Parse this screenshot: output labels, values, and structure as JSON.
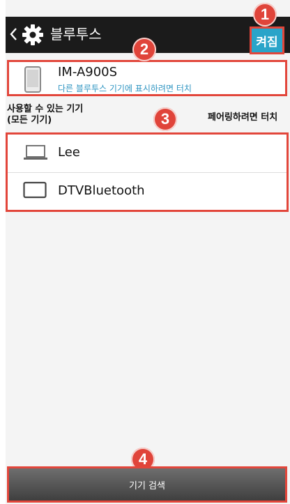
{
  "topbar": {
    "title": "블루투스",
    "toggle_label": "켜짐"
  },
  "device": {
    "name": "IM-A900S",
    "subtitle": "다른 블루투스 기기에 표시하려면 터치"
  },
  "available": {
    "title": "사용할 수 있는 기기",
    "subtitle": "(모든 기기)",
    "hint": "페어링하려면 터치",
    "items": [
      {
        "label": "Lee",
        "icon": "laptop-icon"
      },
      {
        "label": "DTVBluetooth",
        "icon": "tv-icon"
      }
    ]
  },
  "scan_button": {
    "label": "기기 검색"
  },
  "badges": [
    "1",
    "2",
    "3",
    "4"
  ],
  "colors": {
    "accent": "#2aa4c9",
    "highlight": "#e2463b",
    "topbar": "#1b1b1b",
    "link": "#2f95c2"
  }
}
